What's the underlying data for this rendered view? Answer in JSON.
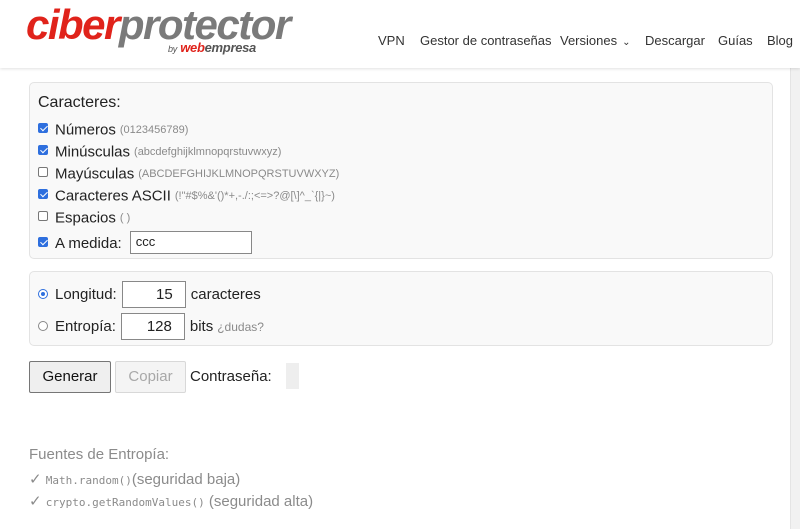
{
  "header": {
    "logo_part1": "ciber",
    "logo_part2": "protector",
    "logo_by": "by",
    "logo_web": "web",
    "logo_empresa": "empresa",
    "nav": [
      {
        "label": "VPN"
      },
      {
        "label": "Gestor de contraseñas"
      },
      {
        "label": "Versiones"
      },
      {
        "label": "Descargar"
      },
      {
        "label": "Guías"
      },
      {
        "label": "Blog"
      }
    ]
  },
  "characters": {
    "title": "Caracteres:",
    "options": [
      {
        "label": "Números",
        "hint": "(0123456789)",
        "checked": true
      },
      {
        "label": "Minúsculas",
        "hint": "(abcdefghijklmnopqrstuvwxyz)",
        "checked": true
      },
      {
        "label": "Mayúsculas",
        "hint": "(ABCDEFGHIJKLMNOPQRSTUVWXYZ)",
        "checked": false
      },
      {
        "label": "Caracteres ASCII",
        "hint": "(!\"#$%&'()*+,-./:;<=>?@[\\]^_`{|}~)",
        "checked": true
      },
      {
        "label": "Espacios",
        "hint": "( )",
        "checked": false
      }
    ],
    "custom": {
      "label": "A medida:",
      "value": "ccc",
      "checked": true
    }
  },
  "size": {
    "length": {
      "label": "Longitud:",
      "value": "15",
      "suffix": "caracteres",
      "selected": true
    },
    "entropy": {
      "label": "Entropía:",
      "value": "128",
      "suffix": "bits",
      "hint": "¿dudas?",
      "selected": false
    }
  },
  "actions": {
    "generate": "Generar",
    "copy": "Copiar",
    "password_label": "Contraseña:"
  },
  "sources": {
    "title": "Fuentes de Entropía:",
    "items": [
      {
        "check": "✓",
        "code": "Math.random()",
        "desc": "(seguridad baja)"
      },
      {
        "check": "✓",
        "code": "crypto.getRandomValues()",
        "desc": "(seguridad alta)"
      }
    ]
  },
  "colors": {
    "brand_red": "#e0231b",
    "brand_gray": "#7a7a7a",
    "accent_blue": "#2e6fde"
  },
  "icons": {
    "checkbox": "checkbox-icon",
    "radio": "radio-icon",
    "dropdown": "chevron-down-icon"
  }
}
